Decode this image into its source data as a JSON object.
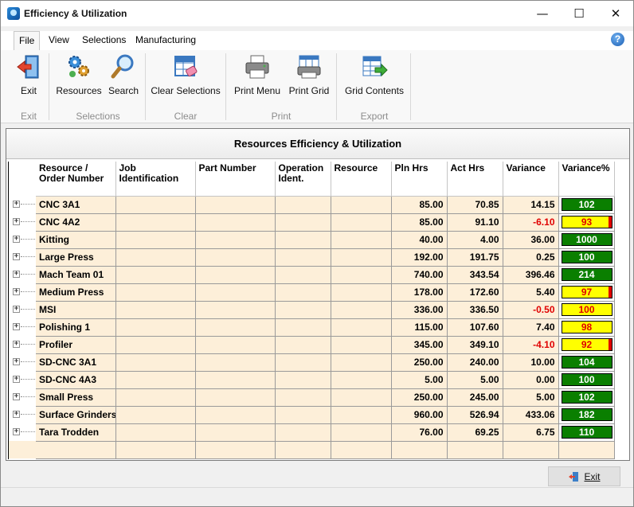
{
  "window": {
    "title": "Efficiency & Utilization",
    "minimize": "—",
    "maximize": "☐",
    "close": "✕"
  },
  "menu": {
    "items": [
      "File",
      "View",
      "Selections",
      "Manufacturing"
    ],
    "help": "?"
  },
  "ribbon": {
    "buttons": {
      "exit": "Exit",
      "resources": "Resources",
      "search": "Search",
      "clear_selections": "Clear Selections",
      "print_menu": "Print Menu",
      "print_grid": "Print Grid",
      "grid_contents": "Grid Contents"
    },
    "groups": {
      "exit": "Exit",
      "selections": "Selections",
      "clear": "Clear",
      "print": "Print",
      "export": "Export"
    }
  },
  "panel": {
    "title": "Resources Efficiency & Utilization"
  },
  "grid": {
    "columns": [
      "Resource /\nOrder Number",
      "Job\nIdentification",
      "Part Number",
      "Operation\nIdent.",
      "Resource",
      "Pln Hrs",
      "Act Hrs",
      "Variance",
      "Variance%"
    ],
    "expander": "+",
    "rows": [
      {
        "name": "CNC 3A1",
        "pln": "85.00",
        "act": "70.85",
        "var": "14.15",
        "pct": "102",
        "status": "good"
      },
      {
        "name": "CNC 4A2",
        "pln": "85.00",
        "act": "91.10",
        "var": "-6.10",
        "pct": "93",
        "status": "warn-bar"
      },
      {
        "name": "Kitting",
        "pln": "40.00",
        "act": "4.00",
        "var": "36.00",
        "pct": "1000",
        "status": "good"
      },
      {
        "name": "Large Press",
        "pln": "192.00",
        "act": "191.75",
        "var": "0.25",
        "pct": "100",
        "status": "good"
      },
      {
        "name": "Mach Team 01",
        "pln": "740.00",
        "act": "343.54",
        "var": "396.46",
        "pct": "214",
        "status": "good"
      },
      {
        "name": "Medium Press",
        "pln": "178.00",
        "act": "172.60",
        "var": "5.40",
        "pct": "97",
        "status": "warn-bar"
      },
      {
        "name": "MSI",
        "pln": "336.00",
        "act": "336.50",
        "var": "-0.50",
        "pct": "100",
        "status": "warn"
      },
      {
        "name": "Polishing 1",
        "pln": "115.00",
        "act": "107.60",
        "var": "7.40",
        "pct": "98",
        "status": "warn"
      },
      {
        "name": "Profiler",
        "pln": "345.00",
        "act": "349.10",
        "var": "-4.10",
        "pct": "92",
        "status": "warn-bar"
      },
      {
        "name": "SD-CNC 3A1",
        "pln": "250.00",
        "act": "240.00",
        "var": "10.00",
        "pct": "104",
        "status": "good"
      },
      {
        "name": "SD-CNC 4A3",
        "pln": "5.00",
        "act": "5.00",
        "var": "0.00",
        "pct": "100",
        "status": "good"
      },
      {
        "name": "Small Press",
        "pln": "250.00",
        "act": "245.00",
        "var": "5.00",
        "pct": "102",
        "status": "good"
      },
      {
        "name": "Surface Grinders",
        "pln": "960.00",
        "act": "526.94",
        "var": "433.06",
        "pct": "182",
        "status": "good"
      },
      {
        "name": "Tara Trodden",
        "pln": "76.00",
        "act": "69.25",
        "var": "6.75",
        "pct": "110",
        "status": "good"
      }
    ]
  },
  "footer": {
    "exit_label": "Exit"
  },
  "colors": {
    "good": "#0a7f00",
    "warn": "#ffff00",
    "negative": "#e00000",
    "row_bg": "#fdefd9"
  }
}
